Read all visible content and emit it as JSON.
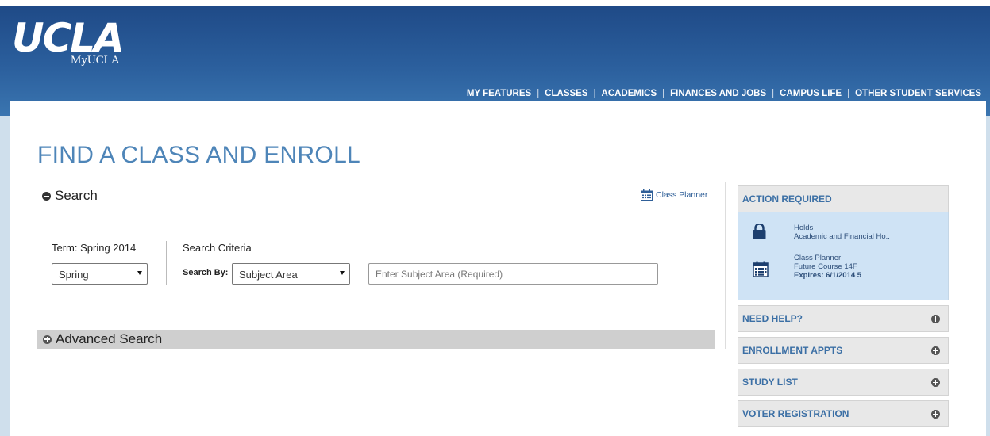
{
  "header": {
    "logo": "UCLA",
    "logo_sub": "MyUCLA",
    "nav": [
      "MY FEATURES",
      "CLASSES",
      "ACADEMICS",
      "FINANCES AND JOBS",
      "CAMPUS LIFE",
      "OTHER STUDENT SERVICES"
    ],
    "nav_separator": "|"
  },
  "page": {
    "title": "FIND A CLASS AND ENROLL"
  },
  "search": {
    "heading": "Search",
    "class_planner_link": "Class Planner",
    "term_label": "Term: Spring 2014",
    "term_value": "Spring",
    "criteria_label": "Search Criteria",
    "search_by_label": "Search By:",
    "search_by_value": "Subject Area",
    "subject_placeholder": "Enter Subject Area (Required)",
    "advanced_label": "Advanced Search"
  },
  "sidebar": {
    "action_required": {
      "title": "ACTION REQUIRED",
      "holds_title": "Holds",
      "holds_detail": "Academic and Financial Ho..",
      "planner_title": "Class Planner",
      "planner_detail": "Future Course 14F",
      "planner_expires": "Expires: 6/1/2014 5"
    },
    "panels": [
      "NEED HELP?",
      "ENROLLMENT APPTS",
      "STUDY LIST",
      "VOTER REGISTRATION"
    ]
  },
  "colors": {
    "header_blue": "#2b5f9d",
    "title_blue": "#4e85b8",
    "panel_link": "#3b6fa5",
    "action_bg": "#cfe3f5"
  }
}
